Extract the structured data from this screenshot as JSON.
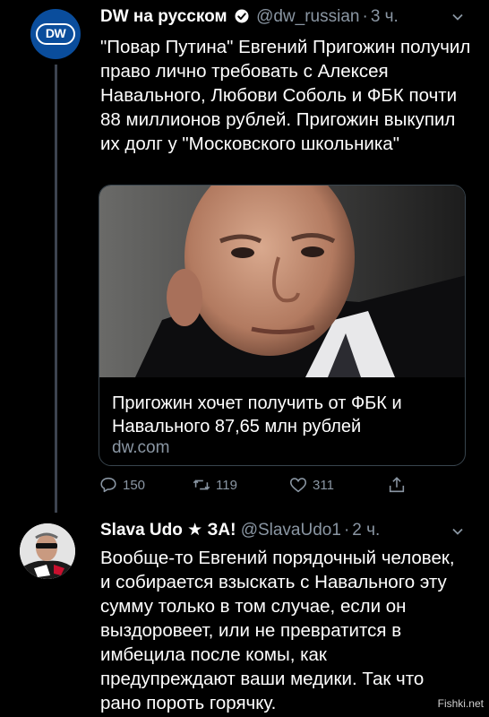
{
  "tweet1": {
    "avatar_label": "DW",
    "name": "DW на русском",
    "handle": "@dw_russian",
    "time": "3 ч.",
    "text": "\"Повар Путина\" Евгений Пригожин получил право лично требовать с Алексея Навального, Любови Соболь и ФБК почти 88 миллионов рублей. Пригожин выкупил их долг у \"Московского школьника\"",
    "card": {
      "title": "Пригожин хочет получить от ФБК и Навального 87,65 млн рублей",
      "domain": "dw.com"
    },
    "actions": {
      "replies": "150",
      "retweets": "119",
      "likes": "311"
    }
  },
  "tweet2": {
    "name": "Slava Udo ★ ЗА!",
    "handle": "@SlavaUdo1",
    "time": "2 ч.",
    "text": "Вообще-то Евгений порядочный человек, и собирается взыскать с Навального эту сумму только в том случае, если он выздоровеет, или не превратится в имбецила после комы, как предупреждают ваши медики. Так что рано пороть горячку."
  },
  "watermark": "Fishki.net",
  "icons": {
    "verified": "verified-badge-icon",
    "more": "chevron-down-icon",
    "reply": "reply-icon",
    "retweet": "retweet-icon",
    "like": "heart-icon",
    "share": "share-icon"
  },
  "colors": {
    "background": "#000000",
    "text": "#ffffff",
    "secondary": "#8a96a3",
    "border": "#38444d",
    "dw_blue": "#0a4d9c"
  }
}
